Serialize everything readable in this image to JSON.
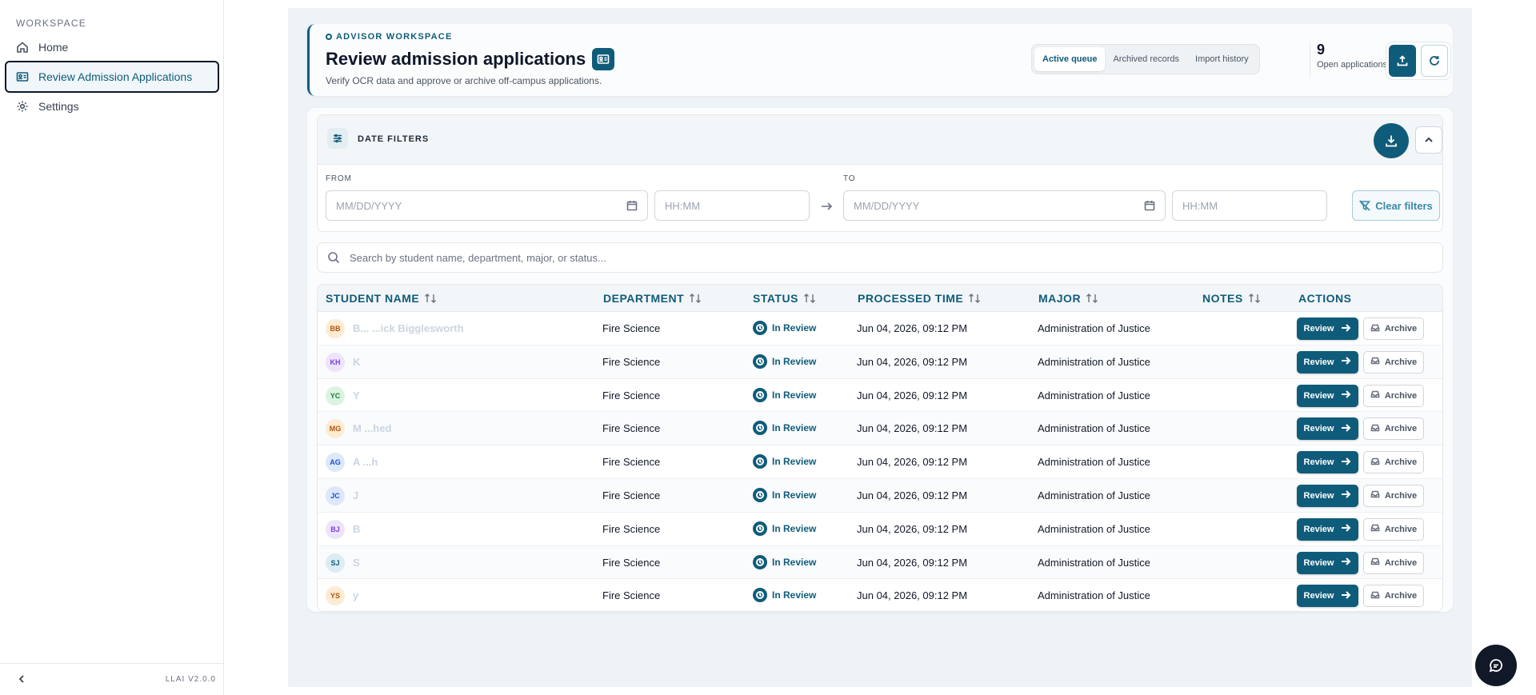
{
  "sidebar": {
    "section_label": "WORKSPACE",
    "items": [
      {
        "label": "Home",
        "icon": "home-icon"
      },
      {
        "label": "Review Admission Applications",
        "icon": "id-card-icon",
        "active": true
      },
      {
        "label": "Settings",
        "icon": "gear-icon"
      }
    ],
    "version": "LLAI V2.0.0"
  },
  "header": {
    "eyebrow": "ADVISOR WORKSPACE",
    "title": "Review admission applications",
    "subtitle": "Verify OCR data and approve or archive off-campus applications.",
    "tabs": [
      "Active queue",
      "Archived records",
      "Import history"
    ],
    "active_tab": "Active queue",
    "count": "9",
    "count_label": "Open applications"
  },
  "filters": {
    "title": "DATE FILTERS",
    "from_label": "FROM",
    "to_label": "TO",
    "from_date_placeholder": "MM/DD/YYYY",
    "from_time_placeholder": "HH:MM",
    "to_date_placeholder": "MM/DD/YYYY",
    "to_time_placeholder": "HH:MM",
    "clear_label": "Clear filters"
  },
  "search": {
    "placeholder": "Search by student name, department, major, or status..."
  },
  "table": {
    "columns": [
      "STUDENT NAME",
      "DEPARTMENT",
      "STATUS",
      "PROCESSED TIME",
      "MAJOR",
      "NOTES",
      "ACTIONS"
    ],
    "review_label": "Review",
    "archive_label": "Archive",
    "rows": [
      {
        "initials": "BB",
        "name": "B... ...ick Bigglesworth",
        "department": "Fire Science",
        "status": "In Review",
        "time": "Jun 04, 2026, 09:12 PM",
        "major": "Administration of Justice",
        "avatar_bg": "#fdebd3",
        "avatar_fg": "#b45309"
      },
      {
        "initials": "KH",
        "name": "K",
        "department": "Fire Science",
        "status": "In Review",
        "time": "Jun 04, 2026, 09:12 PM",
        "major": "Administration of Justice",
        "avatar_bg": "#ede4fb",
        "avatar_fg": "#7c3aed"
      },
      {
        "initials": "YC",
        "name": "Y",
        "department": "Fire Science",
        "status": "In Review",
        "time": "Jun 04, 2026, 09:12 PM",
        "major": "Administration of Justice",
        "avatar_bg": "#dcf3e2",
        "avatar_fg": "#15803d"
      },
      {
        "initials": "MG",
        "name": "M ...hed",
        "department": "Fire Science",
        "status": "In Review",
        "time": "Jun 04, 2026, 09:12 PM",
        "major": "Administration of Justice",
        "avatar_bg": "#fdebd3",
        "avatar_fg": "#b45309"
      },
      {
        "initials": "AG",
        "name": "A ...h",
        "department": "Fire Science",
        "status": "In Review",
        "time": "Jun 04, 2026, 09:12 PM",
        "major": "Administration of Justice",
        "avatar_bg": "#dde8fb",
        "avatar_fg": "#1d4ed8"
      },
      {
        "initials": "JC",
        "name": "J",
        "department": "Fire Science",
        "status": "In Review",
        "time": "Jun 04, 2026, 09:12 PM",
        "major": "Administration of Justice",
        "avatar_bg": "#dde8fb",
        "avatar_fg": "#1d4ed8"
      },
      {
        "initials": "BJ",
        "name": "B",
        "department": "Fire Science",
        "status": "In Review",
        "time": "Jun 04, 2026, 09:12 PM",
        "major": "Administration of Justice",
        "avatar_bg": "#ede4fb",
        "avatar_fg": "#7c3aed"
      },
      {
        "initials": "SJ",
        "name": "S",
        "department": "Fire Science",
        "status": "In Review",
        "time": "Jun 04, 2026, 09:12 PM",
        "major": "Administration of Justice",
        "avatar_bg": "#dcecf3",
        "avatar_fg": "#0f5c7a"
      },
      {
        "initials": "YS",
        "name": "y",
        "department": "Fire Science",
        "status": "In Review",
        "time": "Jun 04, 2026, 09:12 PM",
        "major": "Administration of Justice",
        "avatar_bg": "#fdebd3",
        "avatar_fg": "#b45309"
      }
    ]
  },
  "colors": {
    "accent": "#0f5c7a",
    "dark": "#111827"
  }
}
